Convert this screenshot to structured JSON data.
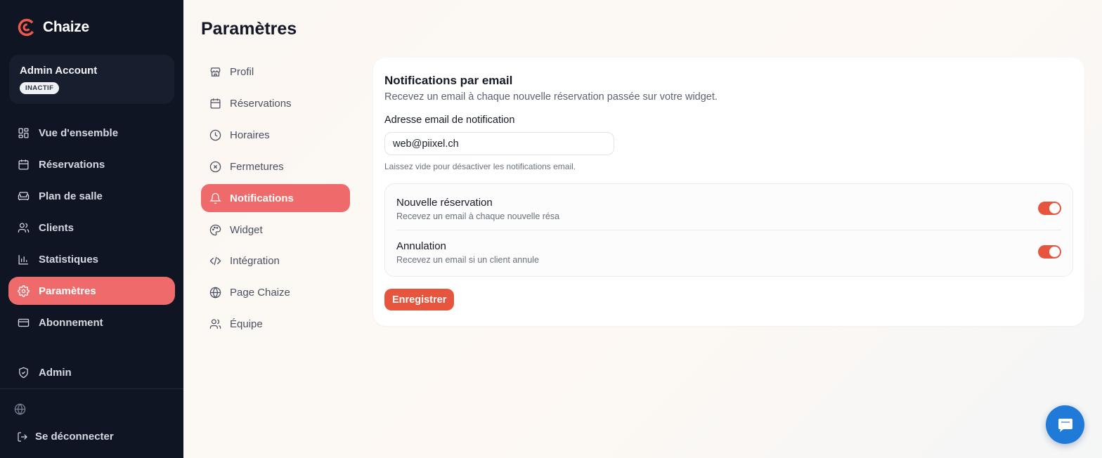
{
  "app": {
    "name": "Chaize",
    "accent": "#ef6b6b",
    "button_color": "#e8553f"
  },
  "account": {
    "name": "Admin Account",
    "status": "INACTIF"
  },
  "sidebar": {
    "items": [
      {
        "label": "Vue d'ensemble",
        "icon": "dashboard-icon"
      },
      {
        "label": "Réservations",
        "icon": "calendar-icon"
      },
      {
        "label": "Plan de salle",
        "icon": "sofa-icon"
      },
      {
        "label": "Clients",
        "icon": "users-icon"
      },
      {
        "label": "Statistiques",
        "icon": "bar-chart-icon"
      },
      {
        "label": "Paramètres",
        "icon": "gear-icon",
        "active": true
      },
      {
        "label": "Abonnement",
        "icon": "credit-card-icon"
      }
    ],
    "admin_label": "Admin",
    "logout_label": "Se déconnecter"
  },
  "page": {
    "title": "Paramètres"
  },
  "settings_nav": {
    "items": [
      {
        "label": "Profil",
        "icon": "store-icon"
      },
      {
        "label": "Réservations",
        "icon": "calendar-icon"
      },
      {
        "label": "Horaires",
        "icon": "clock-icon"
      },
      {
        "label": "Fermetures",
        "icon": "circle-x-icon"
      },
      {
        "label": "Notifications",
        "icon": "bell-icon",
        "active": true
      },
      {
        "label": "Widget",
        "icon": "palette-icon"
      },
      {
        "label": "Intégration",
        "icon": "code-icon"
      },
      {
        "label": "Page Chaize",
        "icon": "globe-icon"
      },
      {
        "label": "Équipe",
        "icon": "users-icon"
      }
    ]
  },
  "notifications": {
    "title": "Notifications par email",
    "description": "Recevez un email à chaque nouvelle réservation passée sur votre widget.",
    "email_label": "Adresse email de notification",
    "email_value": "web@piixel.ch",
    "email_hint": "Laissez vide pour désactiver les notifications email.",
    "toggles": [
      {
        "title": "Nouvelle réservation",
        "subtitle": "Recevez un email à chaque nouvelle résa",
        "enabled": true
      },
      {
        "title": "Annulation",
        "subtitle": "Recevez un email si un client annule",
        "enabled": true
      }
    ],
    "save_label": "Enregistrer"
  }
}
